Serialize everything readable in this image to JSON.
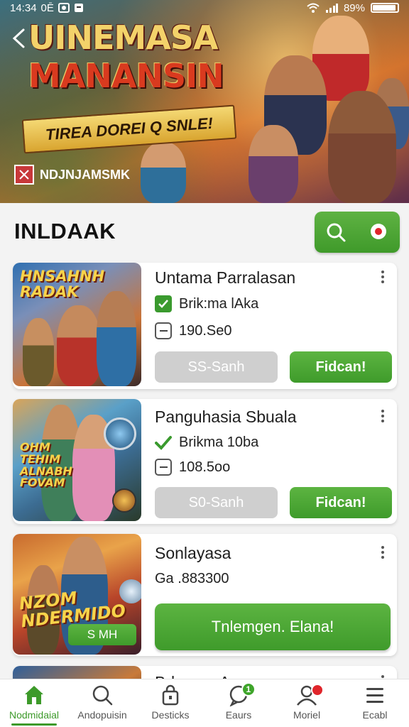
{
  "status_bar": {
    "time": "14:34",
    "left_extra": "0Ē",
    "battery_label": "89%",
    "battery_level": 0.89,
    "icons": [
      "image-icon",
      "notification-icon",
      "wifi-icon",
      "signal-icon",
      "battery-icon"
    ]
  },
  "hero": {
    "title_line1": "UINEMASA",
    "title_line2": "MANANSIN",
    "banner": "TIREA DOREI Q SNLE!",
    "brand": "NDJNJAMSMK"
  },
  "section": {
    "title": "INLDAAK"
  },
  "cards": [
    {
      "title": "Untama Parralasan",
      "thumb_title": "HNSAHNH RADAK",
      "tag": "Brik:ma lAka",
      "price": "190.Se0",
      "secondary_label": "SS-Sanh",
      "primary_label": "Fidcan!"
    },
    {
      "title": "Panguhasia Sbuala",
      "thumb_title": "OHM TEHIM ALNABH FOVAM",
      "tag": "Brikma 10ba",
      "price": "108.5oo",
      "secondary_label": "S0-Sanh",
      "primary_label": "Fidcan!"
    },
    {
      "title": "Sonlayasa",
      "thumb_title": "NZOM NDERMIDO",
      "thumb_badge": "S MH",
      "price": "Ga .883300",
      "primary_label": "Tnlemgen. Elana!"
    },
    {
      "title": "BrluaaesA"
    }
  ],
  "bottom_nav": [
    {
      "label": "Nodmidaial",
      "icon": "home-icon",
      "active": true
    },
    {
      "label": "Andopuisin",
      "icon": "search-icon"
    },
    {
      "label": "Desticks",
      "icon": "bag-icon"
    },
    {
      "label": "Eaurs",
      "icon": "chat-icon",
      "badge": "1"
    },
    {
      "label": "Moriel",
      "icon": "profile-icon",
      "dot": true
    },
    {
      "label": "Ecabl",
      "icon": "menu-icon"
    }
  ],
  "colors": {
    "accent_green": "#3f9b2b",
    "gray_button": "#cfcfcf",
    "alert_red": "#e0252b",
    "title_gold": "#f3d26a",
    "title_red": "#d93a1f"
  }
}
